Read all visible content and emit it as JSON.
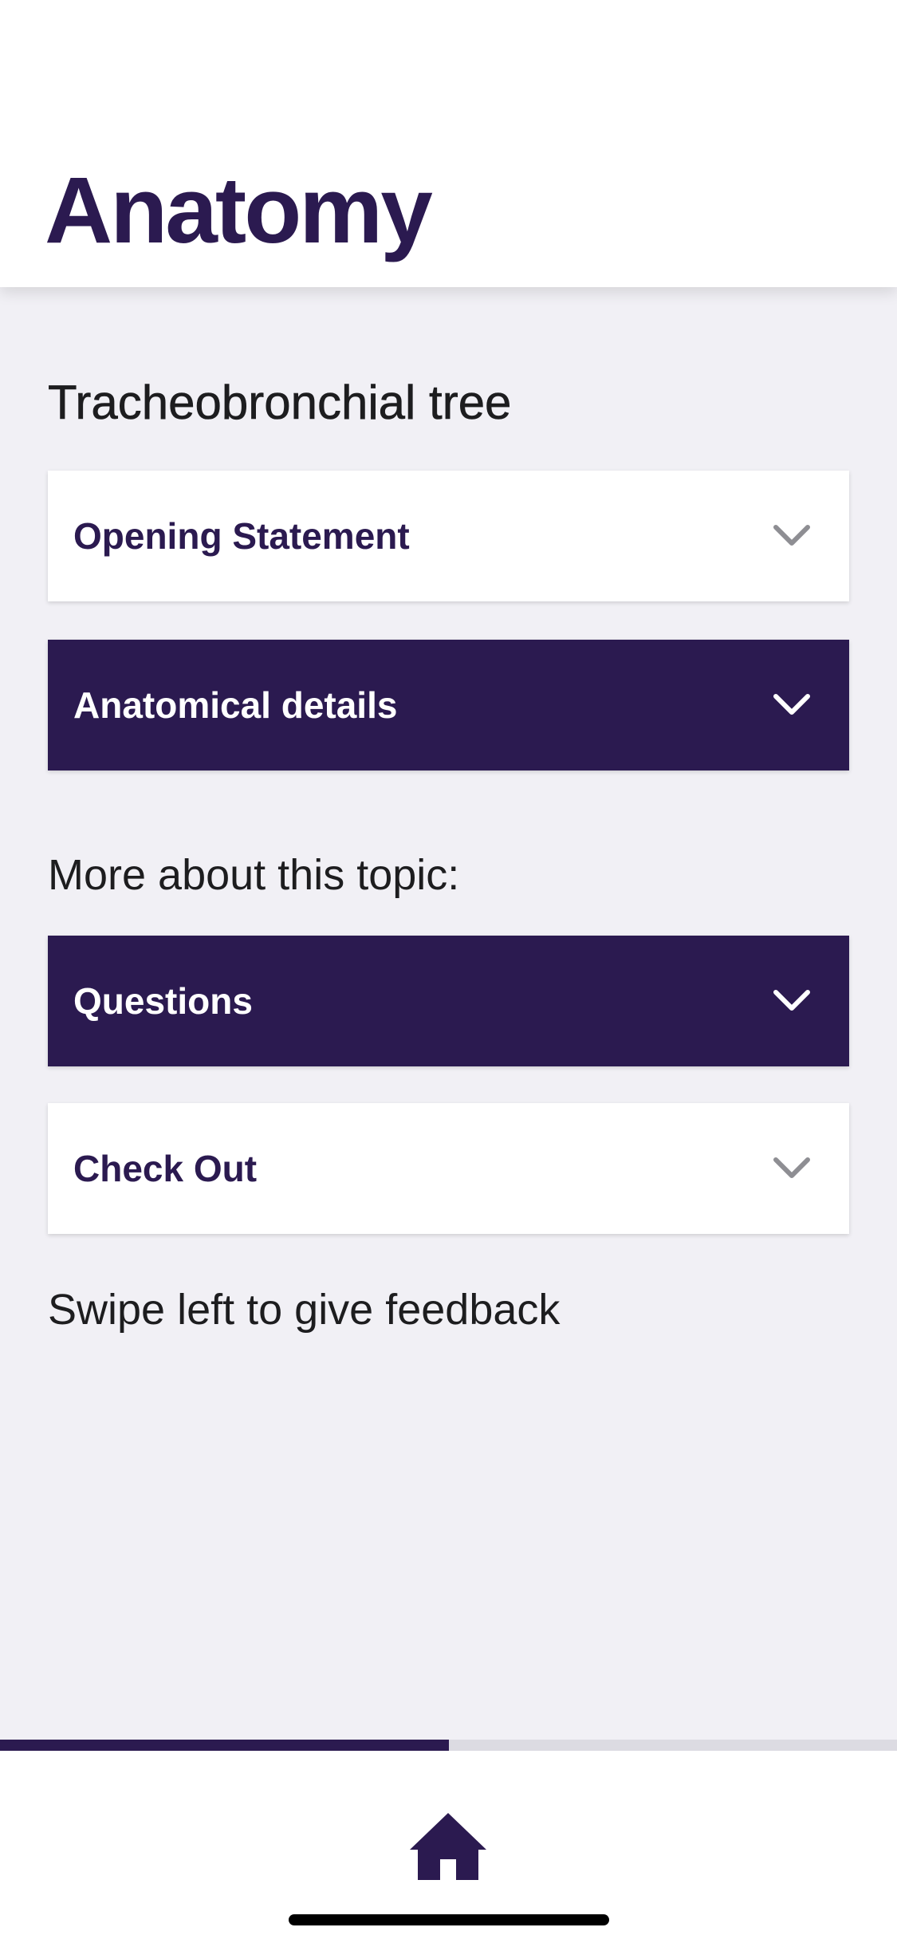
{
  "header": {
    "title": "Anatomy"
  },
  "main": {
    "section_title": "Tracheobronchial tree",
    "accordions": [
      {
        "label": "Opening Statement",
        "style": "light"
      },
      {
        "label": "Anatomical details",
        "style": "dark"
      }
    ],
    "more_label": "More about this topic:",
    "more_accordions": [
      {
        "label": "Questions",
        "style": "dark"
      },
      {
        "label": "Check Out",
        "style": "light"
      }
    ],
    "feedback_hint": "Swipe left to give feedback"
  },
  "progress": {
    "fraction": 0.5
  },
  "tabbar": {
    "icon": "home-icon"
  },
  "colors": {
    "brand": "#2b1a50",
    "background": "#f1f0f5",
    "card": "#ffffff",
    "chevron_light": "#8e8e93"
  }
}
